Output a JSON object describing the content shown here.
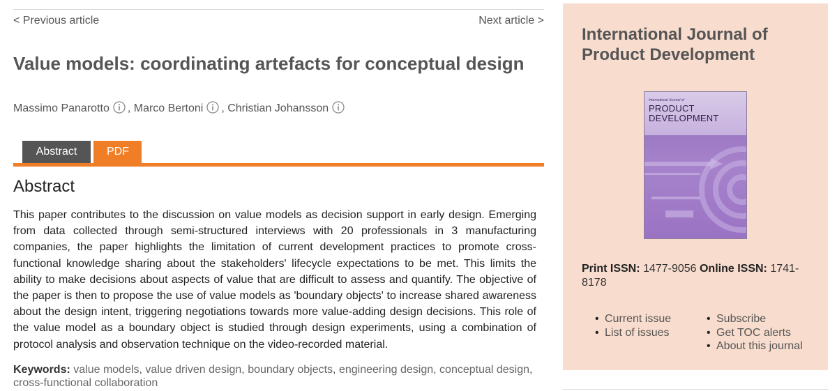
{
  "nav": {
    "prev": "< Previous article",
    "next": "Next article >"
  },
  "article": {
    "title": "Value models: coordinating artefacts for conceptual design",
    "authors": [
      "Massimo Panarotto",
      "Marco Bertoni",
      "Christian Johansson"
    ]
  },
  "tabs": {
    "abstract": "Abstract",
    "pdf": "PDF"
  },
  "abstract": {
    "heading": "Abstract",
    "text": "This paper contributes to the discussion on value models as decision support in early design. Emerging from data collected through semi-structured interviews with 20 professionals in 3 manufacturing companies, the paper highlights the limitation of current development practices to promote cross-functional knowledge sharing about the stakeholders' lifecycle expectations to be met. This limits the ability to make decisions about aspects of value that are difficult to assess and quantify. The objective of the paper is then to propose the use of value models as 'boundary objects' to increase shared awareness about the design intent, triggering negotiations towards more value-adding design decisions. This role of the value model as a boundary object is studied through design experiments, using a combination of protocol analysis and observation technique on the video-recorded material."
  },
  "keywords": {
    "label": "Keywords:",
    "items": [
      "value models",
      "value driven design",
      "boundary objects",
      "engineering design",
      "conceptual design",
      "cross-functional collaboration"
    ]
  },
  "journal": {
    "title": "International Journal of Product Development",
    "cover_small": "International Journal of",
    "cover_line1": "PRODUCT",
    "cover_line2": "DEVELOPMENT",
    "print_issn_label": "Print ISSN:",
    "print_issn": "1477-9056",
    "online_issn_label": "Online ISSN:",
    "online_issn": "1741-8178",
    "links_left": [
      "Current issue",
      "List of issues"
    ],
    "links_right": [
      "Subscribe",
      "Get TOC alerts",
      "About this journal"
    ]
  },
  "colors": {
    "accent": "#f07e26",
    "tab_dark": "#555555",
    "sidebar_bg": "#f8dccd"
  },
  "icons": {
    "author_info": "info-icon"
  }
}
